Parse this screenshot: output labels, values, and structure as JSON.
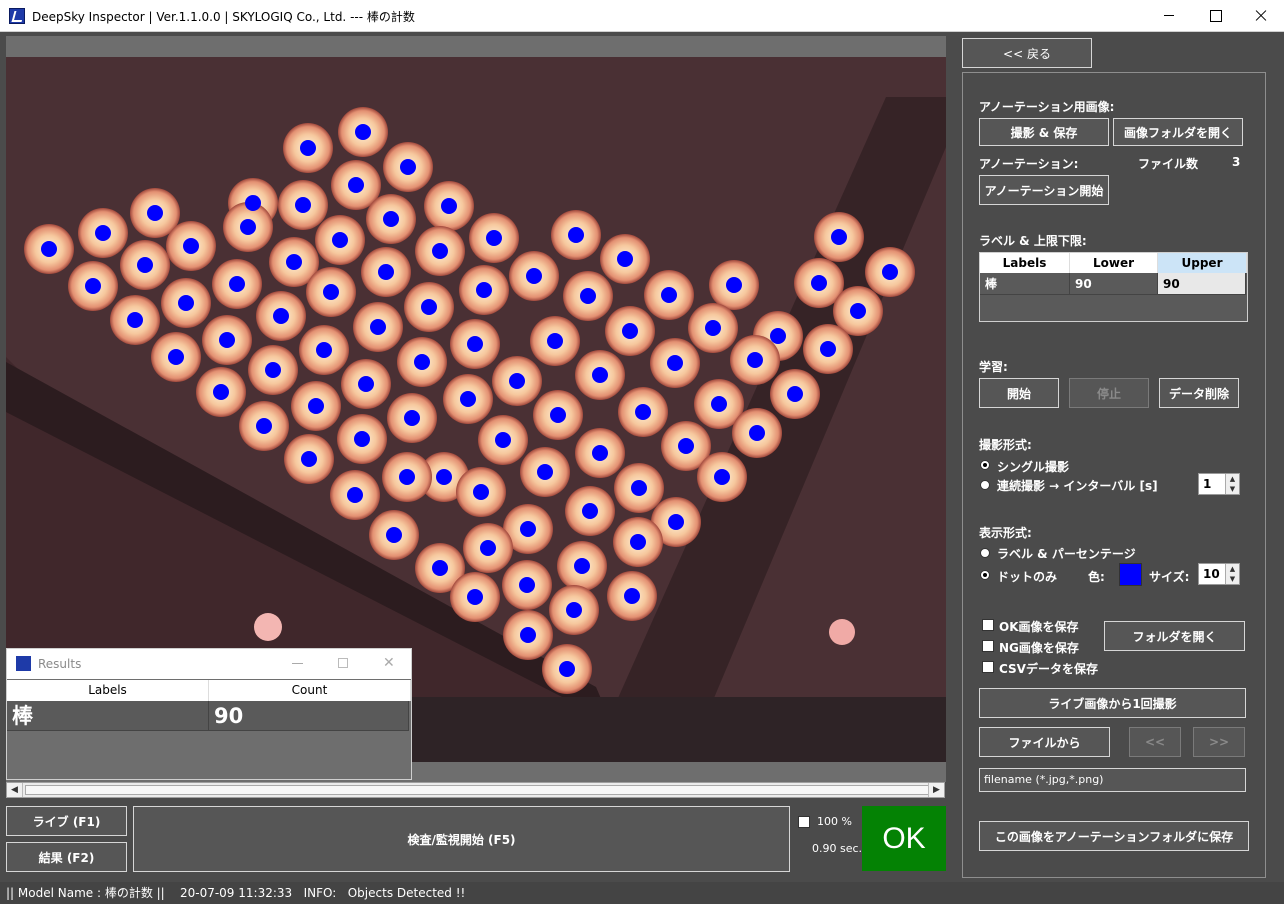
{
  "window": {
    "title": "DeepSky Inspector | Ver.1.1.0.0 | SKYLOGIQ Co., Ltd. --- 棒の計数"
  },
  "results": {
    "title": "Results",
    "columns": [
      "Labels",
      "Count"
    ],
    "rows": [
      {
        "label": "棒",
        "count": "90"
      }
    ]
  },
  "controls": {
    "live": "ライブ (F1)",
    "result": "結果 (F2)",
    "inspect": "検査/監視開始 (F5)",
    "zoom": "100 %",
    "time": "0.90 sec.",
    "ok": "OK"
  },
  "panel": {
    "back": "<< 戻る",
    "annotation_image_heading": "アノーテーション用画像:",
    "capture_save": "撮影 & 保存",
    "open_image_folder": "画像フォルダを開く",
    "annotation_heading": "アノーテーション:",
    "file_count_label": "ファイル数",
    "file_count": "3",
    "start_annotation": "アノーテーション開始",
    "label_limits_heading": "ラベル & 上限下限:",
    "label_table": {
      "columns": [
        "Labels",
        "Lower",
        "Upper"
      ],
      "rows": [
        {
          "label": "棒",
          "lower": "90",
          "upper": "90"
        }
      ]
    },
    "learning_heading": "学習:",
    "learn_start": "開始",
    "learn_stop": "停止",
    "delete_data": "データ削除",
    "capture_mode_heading": "撮影形式:",
    "single_capture": "シングル撮影",
    "continuous_capture": "連続撮影 → インターバル [s]",
    "interval": "1",
    "display_mode_heading": "表示形式:",
    "label_percentage": "ラベル & パーセンテージ",
    "dot_only": "ドットのみ",
    "color_label": "色:",
    "dot_color": "#0000ff",
    "size_label": "サイズ:",
    "size": "10",
    "save_ok": "OK画像を保存",
    "save_ng": "NG画像を保存",
    "save_csv": "CSVデータを保存",
    "open_folder": "フォルダを開く",
    "capture_once": "ライブ画像から1回撮影",
    "from_file": "ファイルから",
    "prev": "<<",
    "next": ">>",
    "filename_value": "filename (*.jpg,*.png)",
    "save_to_annotation": "この画像をアノーテーションフォルダに保存"
  },
  "status": {
    "text": "|| Model Name : 棒の計数 ||    20-07-09 11:32:33   INFO:   Objects Detected !!"
  }
}
